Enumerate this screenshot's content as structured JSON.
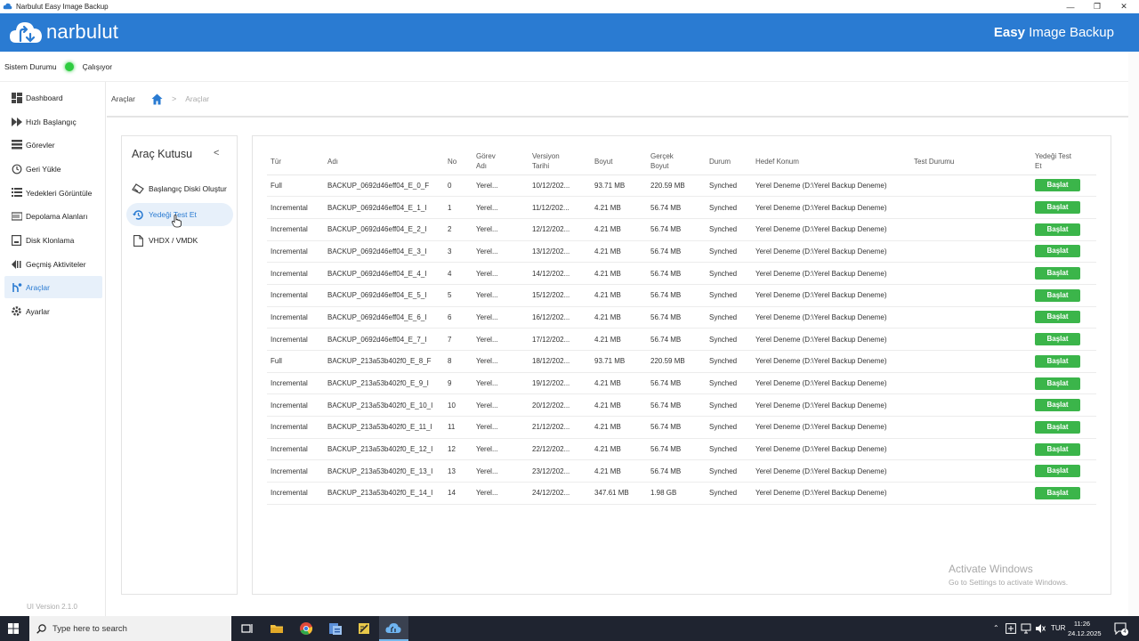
{
  "window": {
    "title": "Narbulut Easy Image Backup"
  },
  "header": {
    "logo": "narbulut",
    "product_bold": "Easy",
    "product_rest": " Image Backup"
  },
  "status": {
    "label": "Sistem Durumu",
    "value": "Çalışıyor",
    "color": "#2ecc40"
  },
  "sidebar": {
    "items": [
      {
        "label": "Dashboard",
        "icon": "dashboard-icon"
      },
      {
        "label": "Hızlı Başlangıç",
        "icon": "fast-forward-icon"
      },
      {
        "label": "Görevler",
        "icon": "list-icon"
      },
      {
        "label": "Geri Yükle",
        "icon": "restore-icon"
      },
      {
        "label": "Yedekleri Görüntüle",
        "icon": "view-list-icon"
      },
      {
        "label": "Depolama Alanları",
        "icon": "storage-icon"
      },
      {
        "label": "Disk Klonlama",
        "icon": "disk-icon"
      },
      {
        "label": "Geçmiş Aktiviteler",
        "icon": "history-icon"
      },
      {
        "label": "Araçlar",
        "icon": "tools-icon",
        "active": true
      },
      {
        "label": "Ayarlar",
        "icon": "settings-icon"
      }
    ],
    "version": "UI Version 2.1.0"
  },
  "breadcrumb": {
    "root": "Araçlar",
    "separator": ">",
    "current": "Araçlar"
  },
  "toolbox": {
    "title": "Araç Kutusu",
    "collapse": "<",
    "items": [
      {
        "label": "Başlangıç Diski Oluştur",
        "icon": "eraser-icon"
      },
      {
        "label": "Yedeği Test Et",
        "icon": "test-restore-icon",
        "active": true
      },
      {
        "label": "VHDX / VMDK",
        "icon": "file-icon"
      }
    ]
  },
  "table": {
    "headers": {
      "type": "Tür",
      "name": "Adı",
      "no": "No",
      "task1": "Görev",
      "task2": "Adı",
      "ver1": "Versiyon",
      "ver2": "Tarihi",
      "size": "Boyut",
      "real1": "Gerçek",
      "real2": "Boyut",
      "state": "Durum",
      "target": "Hedef Konum",
      "test": "Test Durumu",
      "action1": "Yedeği Test",
      "action2": "Et"
    },
    "rows": [
      {
        "type": "Full",
        "name": "BACKUP_0692d46eff04_E_0_F",
        "no": "0",
        "task": "Yerel...",
        "date": "10/12/202...",
        "size": "93.71 MB",
        "real": "220.59 MB",
        "state": "Synched",
        "target": "Yerel Deneme (D:\\Yerel Backup Deneme)",
        "test": "",
        "action": "Başlat"
      },
      {
        "type": "Incremental",
        "name": "BACKUP_0692d46eff04_E_1_I",
        "no": "1",
        "task": "Yerel...",
        "date": "11/12/202...",
        "size": "4.21 MB",
        "real": "56.74 MB",
        "state": "Synched",
        "target": "Yerel Deneme (D:\\Yerel Backup Deneme)",
        "test": "",
        "action": "Başlat"
      },
      {
        "type": "Incremental",
        "name": "BACKUP_0692d46eff04_E_2_I",
        "no": "2",
        "task": "Yerel...",
        "date": "12/12/202...",
        "size": "4.21 MB",
        "real": "56.74 MB",
        "state": "Synched",
        "target": "Yerel Deneme (D:\\Yerel Backup Deneme)",
        "test": "",
        "action": "Başlat"
      },
      {
        "type": "Incremental",
        "name": "BACKUP_0692d46eff04_E_3_I",
        "no": "3",
        "task": "Yerel...",
        "date": "13/12/202...",
        "size": "4.21 MB",
        "real": "56.74 MB",
        "state": "Synched",
        "target": "Yerel Deneme (D:\\Yerel Backup Deneme)",
        "test": "",
        "action": "Başlat"
      },
      {
        "type": "Incremental",
        "name": "BACKUP_0692d46eff04_E_4_I",
        "no": "4",
        "task": "Yerel...",
        "date": "14/12/202...",
        "size": "4.21 MB",
        "real": "56.74 MB",
        "state": "Synched",
        "target": "Yerel Deneme (D:\\Yerel Backup Deneme)",
        "test": "",
        "action": "Başlat"
      },
      {
        "type": "Incremental",
        "name": "BACKUP_0692d46eff04_E_5_I",
        "no": "5",
        "task": "Yerel...",
        "date": "15/12/202...",
        "size": "4.21 MB",
        "real": "56.74 MB",
        "state": "Synched",
        "target": "Yerel Deneme (D:\\Yerel Backup Deneme)",
        "test": "",
        "action": "Başlat"
      },
      {
        "type": "Incremental",
        "name": "BACKUP_0692d46eff04_E_6_I",
        "no": "6",
        "task": "Yerel...",
        "date": "16/12/202...",
        "size": "4.21 MB",
        "real": "56.74 MB",
        "state": "Synched",
        "target": "Yerel Deneme (D:\\Yerel Backup Deneme)",
        "test": "",
        "action": "Başlat"
      },
      {
        "type": "Incremental",
        "name": "BACKUP_0692d46eff04_E_7_I",
        "no": "7",
        "task": "Yerel...",
        "date": "17/12/202...",
        "size": "4.21 MB",
        "real": "56.74 MB",
        "state": "Synched",
        "target": "Yerel Deneme (D:\\Yerel Backup Deneme)",
        "test": "",
        "action": "Başlat"
      },
      {
        "type": "Full",
        "name": "BACKUP_213a53b402f0_E_8_F",
        "no": "8",
        "task": "Yerel...",
        "date": "18/12/202...",
        "size": "93.71 MB",
        "real": "220.59 MB",
        "state": "Synched",
        "target": "Yerel Deneme (D:\\Yerel Backup Deneme)",
        "test": "",
        "action": "Başlat"
      },
      {
        "type": "Incremental",
        "name": "BACKUP_213a53b402f0_E_9_I",
        "no": "9",
        "task": "Yerel...",
        "date": "19/12/202...",
        "size": "4.21 MB",
        "real": "56.74 MB",
        "state": "Synched",
        "target": "Yerel Deneme (D:\\Yerel Backup Deneme)",
        "test": "",
        "action": "Başlat"
      },
      {
        "type": "Incremental",
        "name": "BACKUP_213a53b402f0_E_10_I",
        "no": "10",
        "task": "Yerel...",
        "date": "20/12/202...",
        "size": "4.21 MB",
        "real": "56.74 MB",
        "state": "Synched",
        "target": "Yerel Deneme (D:\\Yerel Backup Deneme)",
        "test": "",
        "action": "Başlat"
      },
      {
        "type": "Incremental",
        "name": "BACKUP_213a53b402f0_E_11_I",
        "no": "11",
        "task": "Yerel...",
        "date": "21/12/202...",
        "size": "4.21 MB",
        "real": "56.74 MB",
        "state": "Synched",
        "target": "Yerel Deneme (D:\\Yerel Backup Deneme)",
        "test": "",
        "action": "Başlat"
      },
      {
        "type": "Incremental",
        "name": "BACKUP_213a53b402f0_E_12_I",
        "no": "12",
        "task": "Yerel...",
        "date": "22/12/202...",
        "size": "4.21 MB",
        "real": "56.74 MB",
        "state": "Synched",
        "target": "Yerel Deneme (D:\\Yerel Backup Deneme)",
        "test": "",
        "action": "Başlat"
      },
      {
        "type": "Incremental",
        "name": "BACKUP_213a53b402f0_E_13_I",
        "no": "13",
        "task": "Yerel...",
        "date": "23/12/202...",
        "size": "4.21 MB",
        "real": "56.74 MB",
        "state": "Synched",
        "target": "Yerel Deneme (D:\\Yerel Backup Deneme)",
        "test": "",
        "action": "Başlat"
      },
      {
        "type": "Incremental",
        "name": "BACKUP_213a53b402f0_E_14_I",
        "no": "14",
        "task": "Yerel...",
        "date": "24/12/202...",
        "size": "347.61 MB",
        "real": "1.98 GB",
        "state": "Synched",
        "target": "Yerel Deneme (D:\\Yerel Backup Deneme)",
        "test": "",
        "action": "Başlat"
      }
    ]
  },
  "watermark": {
    "line1": "Activate Windows",
    "line2": "Go to Settings to activate Windows."
  },
  "taskbar": {
    "search_placeholder": "Type here to search",
    "language": "TUR",
    "time": "11:26",
    "date": "24.12.2025",
    "notification_count": "4"
  },
  "colors": {
    "accent": "#2a7bd2",
    "status_green": "#2ecc40",
    "button_green": "#3bb54a"
  }
}
